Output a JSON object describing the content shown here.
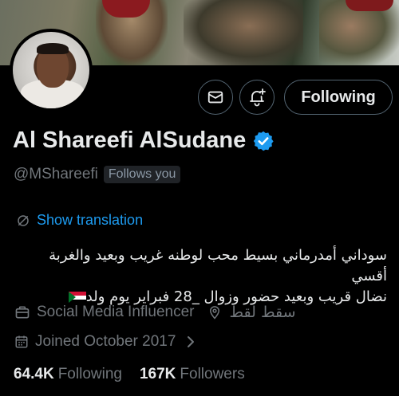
{
  "profile": {
    "display_name": "Al Shareefi AlSudane",
    "handle": "@MShareefi",
    "follows_you": "Follows you",
    "show_translation": "Show translation",
    "bio_line1": "سوداني أمدرماني بسيط محب لوطنه غريب وبعيد والغربة أقسي",
    "bio_line2": "نضال قريب وبعيد حضور وزوال _28 فبراير يوم ولد",
    "category": "Social Media Influencer",
    "location": "سقط لقط",
    "joined": "Joined October 2017",
    "following_count": "64.4K",
    "following_label": "Following",
    "followers_count": "167K",
    "followers_label": "Followers"
  },
  "actions": {
    "follow_button": "Following"
  },
  "icons": {
    "message": "envelope-icon",
    "notify": "bell-plus-icon",
    "verified": "verified-badge-icon",
    "translate": "translate-icon",
    "category": "briefcase-icon",
    "location": "location-pin-icon",
    "calendar": "calendar-icon",
    "chevron": "chevron-right-icon"
  },
  "colors": {
    "background": "#000000",
    "text_primary": "#e7e9ea",
    "text_secondary": "#71767b",
    "accent": "#1d9bf0",
    "border": "#536471"
  }
}
